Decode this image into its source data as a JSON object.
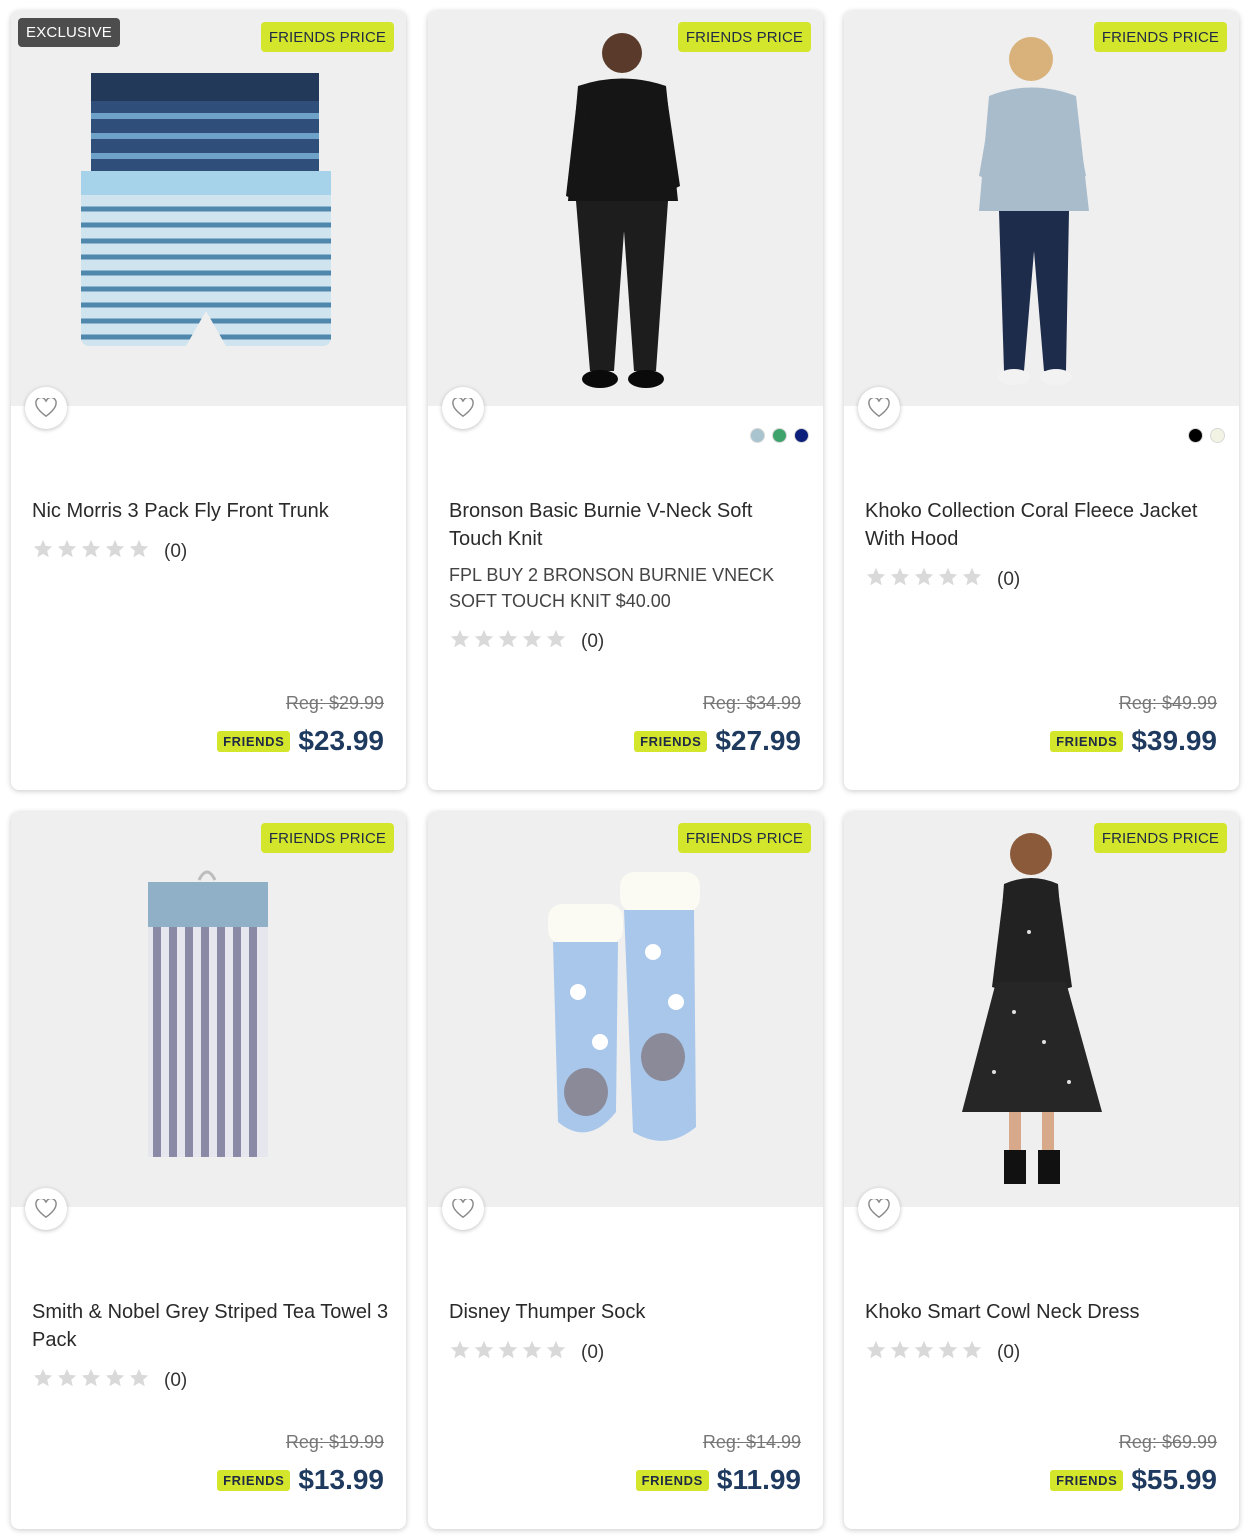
{
  "badges": {
    "exclusive": "EXCLUSIVE",
    "friends_price": "FRIENDS PRICE",
    "friends": "FRIENDS"
  },
  "colors": {
    "accent": "#d4e62b",
    "price": "#1f3a5f",
    "image_bg": "#efefef"
  },
  "products": [
    {
      "title": "Nic Morris 3 Pack Fly Front Trunk",
      "promo": "",
      "rating_count": "(0)",
      "reg_price": "Reg: $29.99",
      "price": "$23.99",
      "swatches": []
    },
    {
      "title": "Bronson Basic Burnie V-Neck Soft Touch Knit",
      "promo": "FPL BUY 2 BRONSON BURNIE VNECK SOFT TOUCH KNIT $40.00",
      "rating_count": "(0)",
      "reg_price": "Reg: $34.99",
      "price": "$27.99",
      "swatches": [
        "#a9c3cf",
        "#3ea36b",
        "#0c1f7a"
      ]
    },
    {
      "title": "Khoko Collection Coral Fleece Jacket With Hood",
      "promo": "",
      "rating_count": "(0)",
      "reg_price": "Reg: $49.99",
      "price": "$39.99",
      "swatches": [
        "#000000",
        "#f2f3e3"
      ]
    },
    {
      "title": "Smith & Nobel Grey Striped Tea Towel 3 Pack",
      "promo": "",
      "rating_count": "(0)",
      "reg_price": "Reg: $19.99",
      "price": "$13.99",
      "swatches": []
    },
    {
      "title": "Disney Thumper Sock",
      "promo": "",
      "rating_count": "(0)",
      "reg_price": "Reg: $14.99",
      "price": "$11.99",
      "swatches": []
    },
    {
      "title": "Khoko Smart Cowl Neck Dress",
      "promo": "",
      "rating_count": "(0)",
      "reg_price": "Reg: $69.99",
      "price": "$55.99",
      "swatches": []
    }
  ]
}
